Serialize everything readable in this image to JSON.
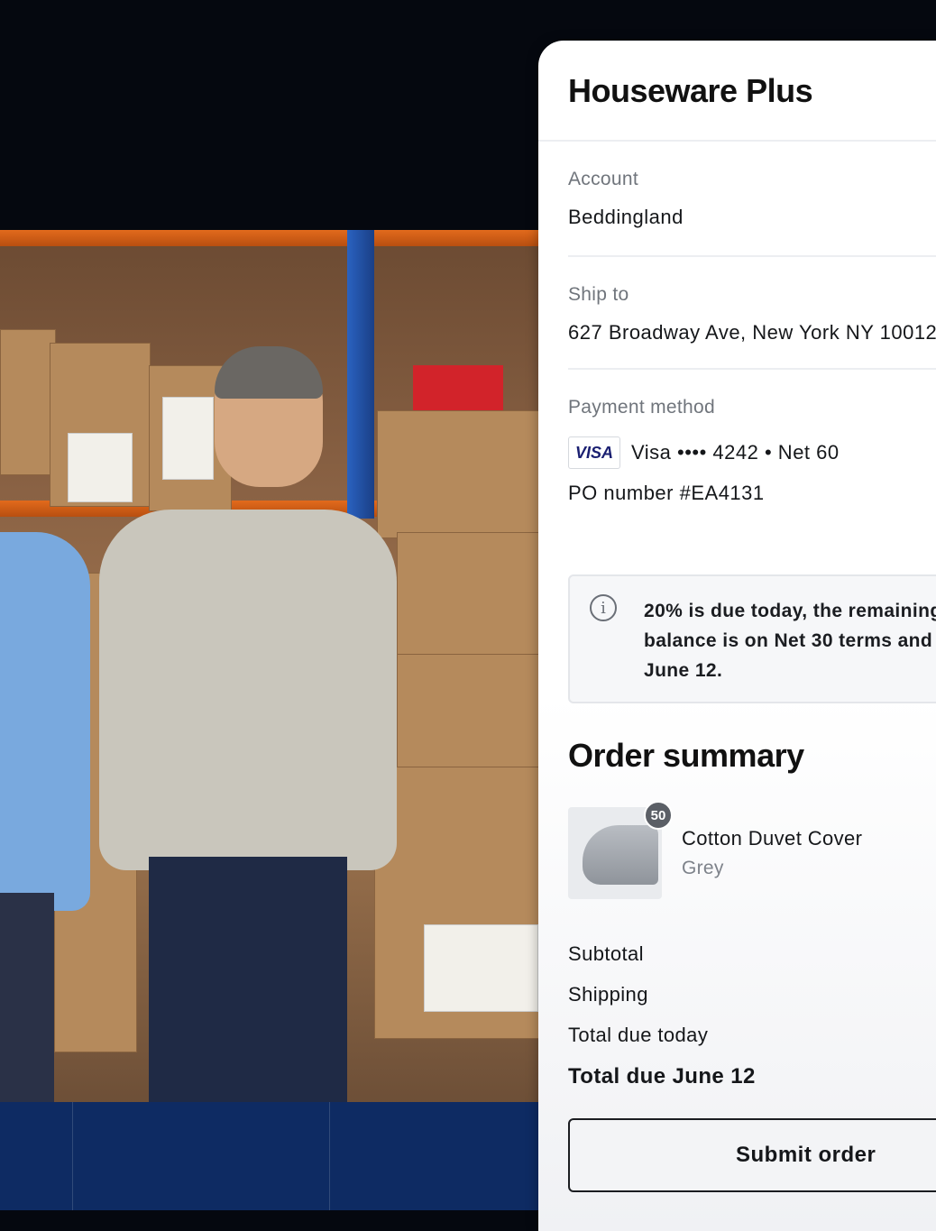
{
  "checkout": {
    "brand": "Houseware Plus",
    "account": {
      "label": "Account",
      "value": "Beddingland"
    },
    "ship_to": {
      "label": "Ship to",
      "value": "627 Broadway Ave, New York NY 10012"
    },
    "payment": {
      "label": "Payment method",
      "card_brand": "VISA",
      "card_text": "Visa •••• 4242 • Net 60",
      "po_number": "PO number #EA4131"
    },
    "notice": {
      "icon": "info-icon",
      "line1": "20% is due today, the remaining",
      "line2": "balance is on Net 30 terms and",
      "line3": "June 12."
    },
    "summary": {
      "title": "Order summary",
      "item": {
        "quantity": "50",
        "name": "Cotton Duvet Cover",
        "variant": "Grey",
        "thumbnail": "duvet-thumbnail"
      },
      "subtotal_label": "Subtotal",
      "shipping_label": "Shipping",
      "total_today_label": "Total due today",
      "total_later_label": "Total due June 12"
    },
    "submit_label": "Submit order"
  },
  "colors": {
    "panel_bg": "#ffffff",
    "visa_blue": "#1a1f71",
    "text_primary": "#15171a",
    "text_muted": "#70757c"
  }
}
